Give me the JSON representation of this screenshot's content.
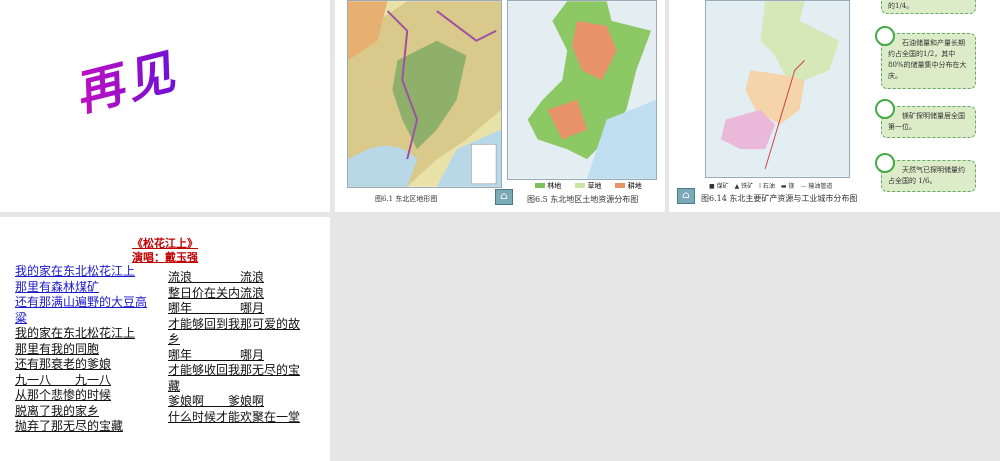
{
  "slide1": {
    "text": "再见"
  },
  "slide2": {
    "caption_left": "图6.1 东北区地形图",
    "caption_right": "图6.5 东北地区土地资源分布图",
    "legend": [
      "林地",
      "草地",
      "耕地"
    ],
    "legend_colors": [
      "#7cc25a",
      "#c8e4a0",
      "#e8926a"
    ]
  },
  "slide3": {
    "caption": "图6.14 东北主要矿产资源与工业城市分布图",
    "legend": [
      "煤矿",
      "铁矿",
      "石油",
      "镁",
      "输油管道"
    ],
    "callouts": [
      "的1/4。",
      "石油储量和产量长期约占全国的1/2，其中80%的储量集中分布在大庆。",
      "镁矿探明储量居全国第一位。",
      "天然气已探明储量约占全国的 1/6。"
    ]
  },
  "slide4": {
    "title": "《松花江上》",
    "singer": "演唱：戴玉强",
    "left": [
      "我的家在东北松花江上",
      "那里有森林煤矿",
      "还有那满山遍野的大豆高",
      "粱",
      "我的家在东北松花江上",
      "那里有我的同胞",
      "还有那衰老的爹娘",
      "九一八　　九一八",
      "从那个悲惨的时候",
      "脱离了我的家乡",
      "抛弃了那无尽的宝藏"
    ],
    "right": [
      "流浪　　　　流浪",
      "整日价在关内流浪",
      "哪年　　　　哪月",
      "才能够回到我那可爱的故",
      "乡",
      "哪年　　　　哪月",
      "才能够收回我那无尽的宝",
      "藏",
      "爹娘啊　　爹娘啊",
      "什么时候才能欢聚在一堂"
    ]
  }
}
